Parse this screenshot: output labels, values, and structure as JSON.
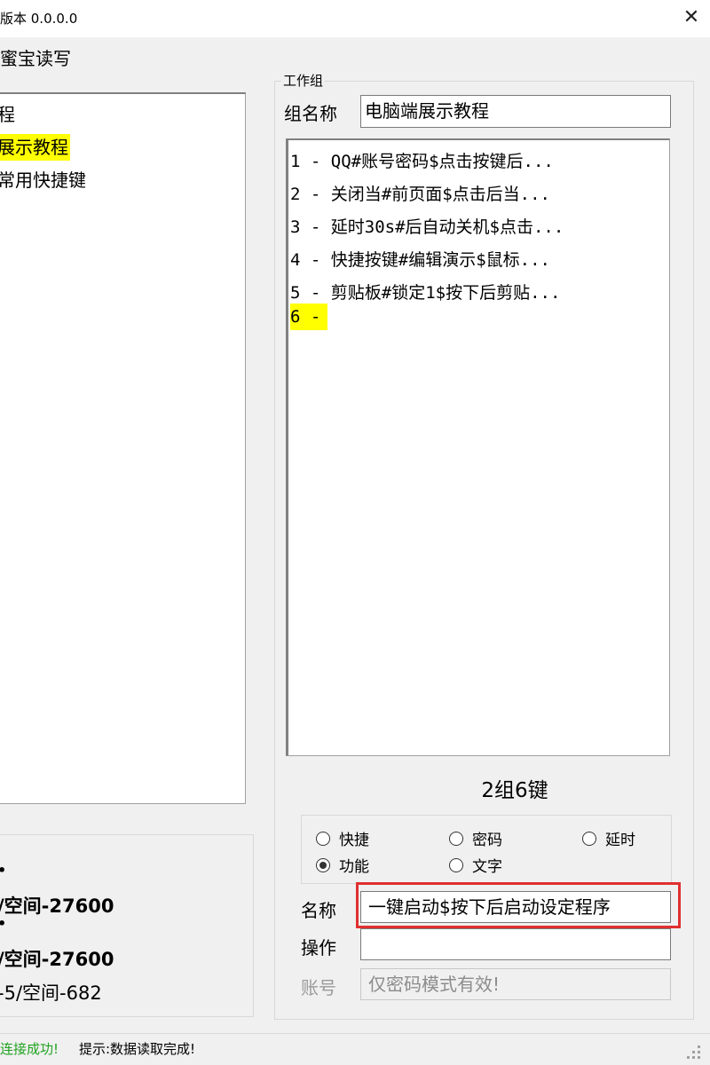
{
  "window": {
    "title": "版本 0.0.0.0",
    "close_glyph": "✕"
  },
  "menu": {
    "item": "蜜宝读写"
  },
  "left_list": {
    "items": [
      {
        "label": "程",
        "selected": false
      },
      {
        "label": "展示教程",
        "selected": true
      },
      {
        "label": "常用快捷键",
        "selected": false
      }
    ]
  },
  "left_info": {
    "bullet1": "•",
    "line1": "/空间-27600",
    "bullet2": "•",
    "line2": "/空间-27600",
    "line3": "-5/空间-682"
  },
  "workgroup": {
    "box_label": "工作组",
    "group_name_label": "组名称",
    "group_name_value": "电脑端展示教程",
    "keys": [
      {
        "label": "1 - QQ#账号密码$点击按键后...",
        "selected": false
      },
      {
        "label": "2 - 关闭当#前页面$点击后当...",
        "selected": false
      },
      {
        "label": "3 - 延时30s#后自动关机$点击...",
        "selected": false
      },
      {
        "label": "4 - 快捷按键#编辑演示$鼠标...",
        "selected": false
      },
      {
        "label": "5 - 剪贴板#锁定1$按下后剪贴...",
        "selected": false
      },
      {
        "label": "6 -",
        "selected": true
      }
    ],
    "summary": "2组6键",
    "modes": [
      {
        "label": "快捷",
        "checked": false
      },
      {
        "label": "密码",
        "checked": false
      },
      {
        "label": "延时",
        "checked": false
      },
      {
        "label": "功能",
        "checked": true
      },
      {
        "label": "文字",
        "checked": false
      }
    ],
    "name_label": "名称",
    "name_value": "一键启动$按下后启动设定程序",
    "op_label": "操作",
    "op_value": "",
    "account_label": "账号",
    "account_placeholder": "仅密码模式有效!"
  },
  "status": {
    "connection": "连接成功!",
    "message": "提示:数据读取完成!"
  },
  "colors": {
    "highlight": "#ffff00",
    "success": "#1fa31f",
    "callout": "#e03030"
  }
}
